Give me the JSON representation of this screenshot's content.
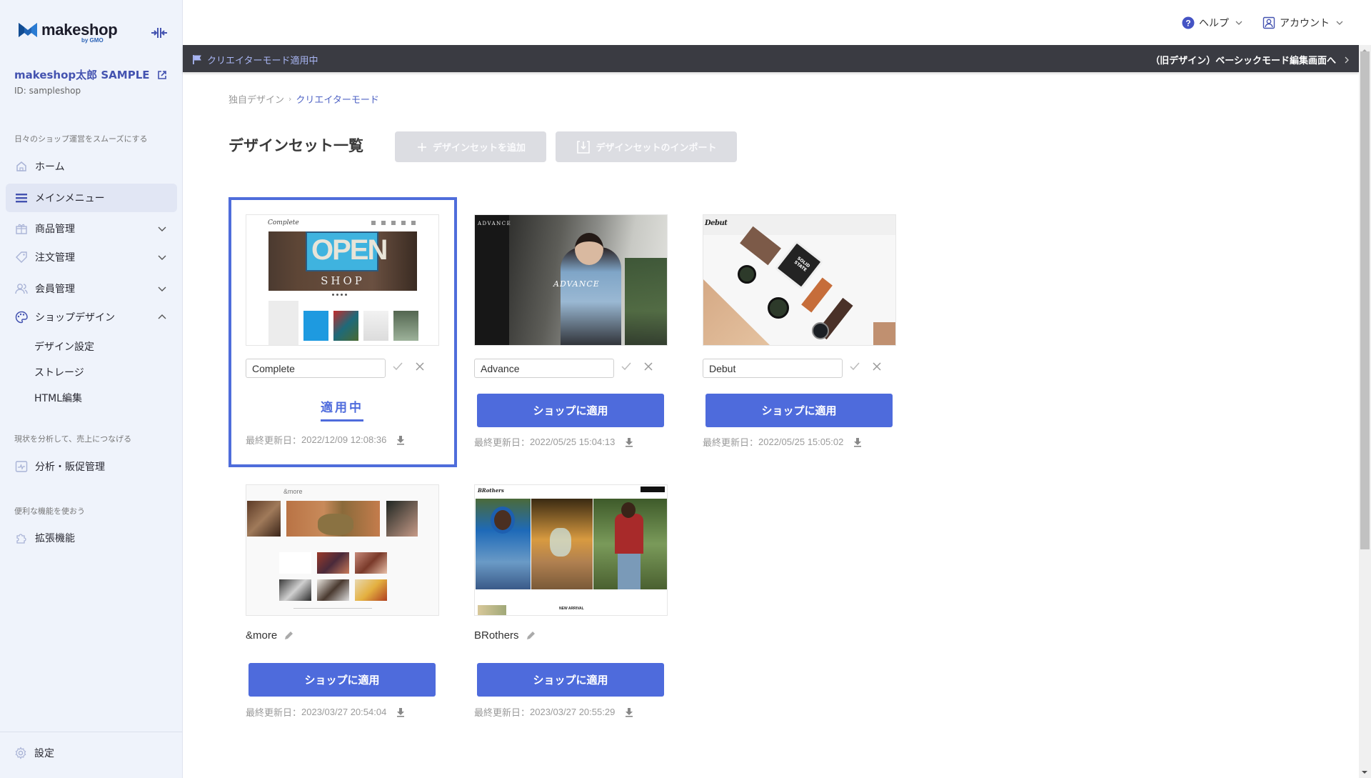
{
  "sidebar": {
    "logo_text": "makeshop",
    "logo_sub": "by GMO",
    "shop_name": "makeshop太郎 SAMPLE",
    "shop_id": "ID: sampleshop",
    "sections": [
      "日々のショップ運営をスムーズにする",
      "現状を分析して、売上につなげる",
      "便利な機能を使おう"
    ],
    "items": [
      {
        "label": "ホーム",
        "icon": "home-icon"
      },
      {
        "label": "メインメニュー",
        "icon": "menu-icon",
        "active": true
      },
      {
        "label": "商品管理",
        "icon": "gift-icon",
        "expandable": true
      },
      {
        "label": "注文管理",
        "icon": "tag-icon",
        "expandable": true
      },
      {
        "label": "会員管理",
        "icon": "users-icon",
        "expandable": true
      },
      {
        "label": "ショップデザイン",
        "icon": "palette-icon",
        "expanded": true
      },
      {
        "label": "分析・販促管理",
        "icon": "analytics-icon"
      },
      {
        "label": "拡張機能",
        "icon": "puzzle-icon"
      }
    ],
    "sub_items": [
      "デザイン設定",
      "ストレージ",
      "HTML編集"
    ],
    "settings_label": "設定"
  },
  "topbar": {
    "help_label": "ヘルプ",
    "account_label": "アカウント"
  },
  "mode_bar": {
    "status_label": "クリエイターモード適用中",
    "basic_mode_link": "（旧デザイン）ベーシックモード編集画面へ"
  },
  "breadcrumb": {
    "parent": "独自デザイン",
    "separator": "›",
    "current": "クリエイターモード"
  },
  "page": {
    "title": "デザインセット一覧",
    "add_button": "デザインセットを追加",
    "import_button": "デザインセットのインポート"
  },
  "design_sets": [
    {
      "name": "Complete",
      "editing": true,
      "applied": true,
      "applied_label": "適用中",
      "updated_prefix": "最終更新日：",
      "updated": "2022/12/09 12:08:36",
      "thumb_title": "Complete"
    },
    {
      "name": "Advance",
      "editing": true,
      "applied": false,
      "apply_label": "ショップに適用",
      "updated_prefix": "最終更新日：",
      "updated": "2022/05/25 15:04:13",
      "thumb_title": "ADVANCE"
    },
    {
      "name": "Debut",
      "editing": true,
      "applied": false,
      "apply_label": "ショップに適用",
      "updated_prefix": "最終更新日：",
      "updated": "2022/05/25 15:05:02",
      "thumb_title": "Debut"
    },
    {
      "name": "&more",
      "editing": false,
      "applied": false,
      "apply_label": "ショップに適用",
      "updated_prefix": "最終更新日：",
      "updated": "2023/03/27 20:54:04",
      "thumb_title": "&more"
    },
    {
      "name": "BRothers",
      "editing": false,
      "applied": false,
      "apply_label": "ショップに適用",
      "updated_prefix": "最終更新日：",
      "updated": "2023/03/27 20:55:29",
      "thumb_title": "BRothers"
    }
  ],
  "thumb_text": {
    "complete_open": "OPEN",
    "complete_shop": "SHOP",
    "advance_overlay": "ADVANCE",
    "debut_box": "SOLID STATE",
    "brothers_new": "NEW ARRIVAL"
  },
  "colors": {
    "accent": "#4e6bdc",
    "sidebar_bg": "#eff3fb",
    "mode_bar_bg": "#3a3b42"
  }
}
